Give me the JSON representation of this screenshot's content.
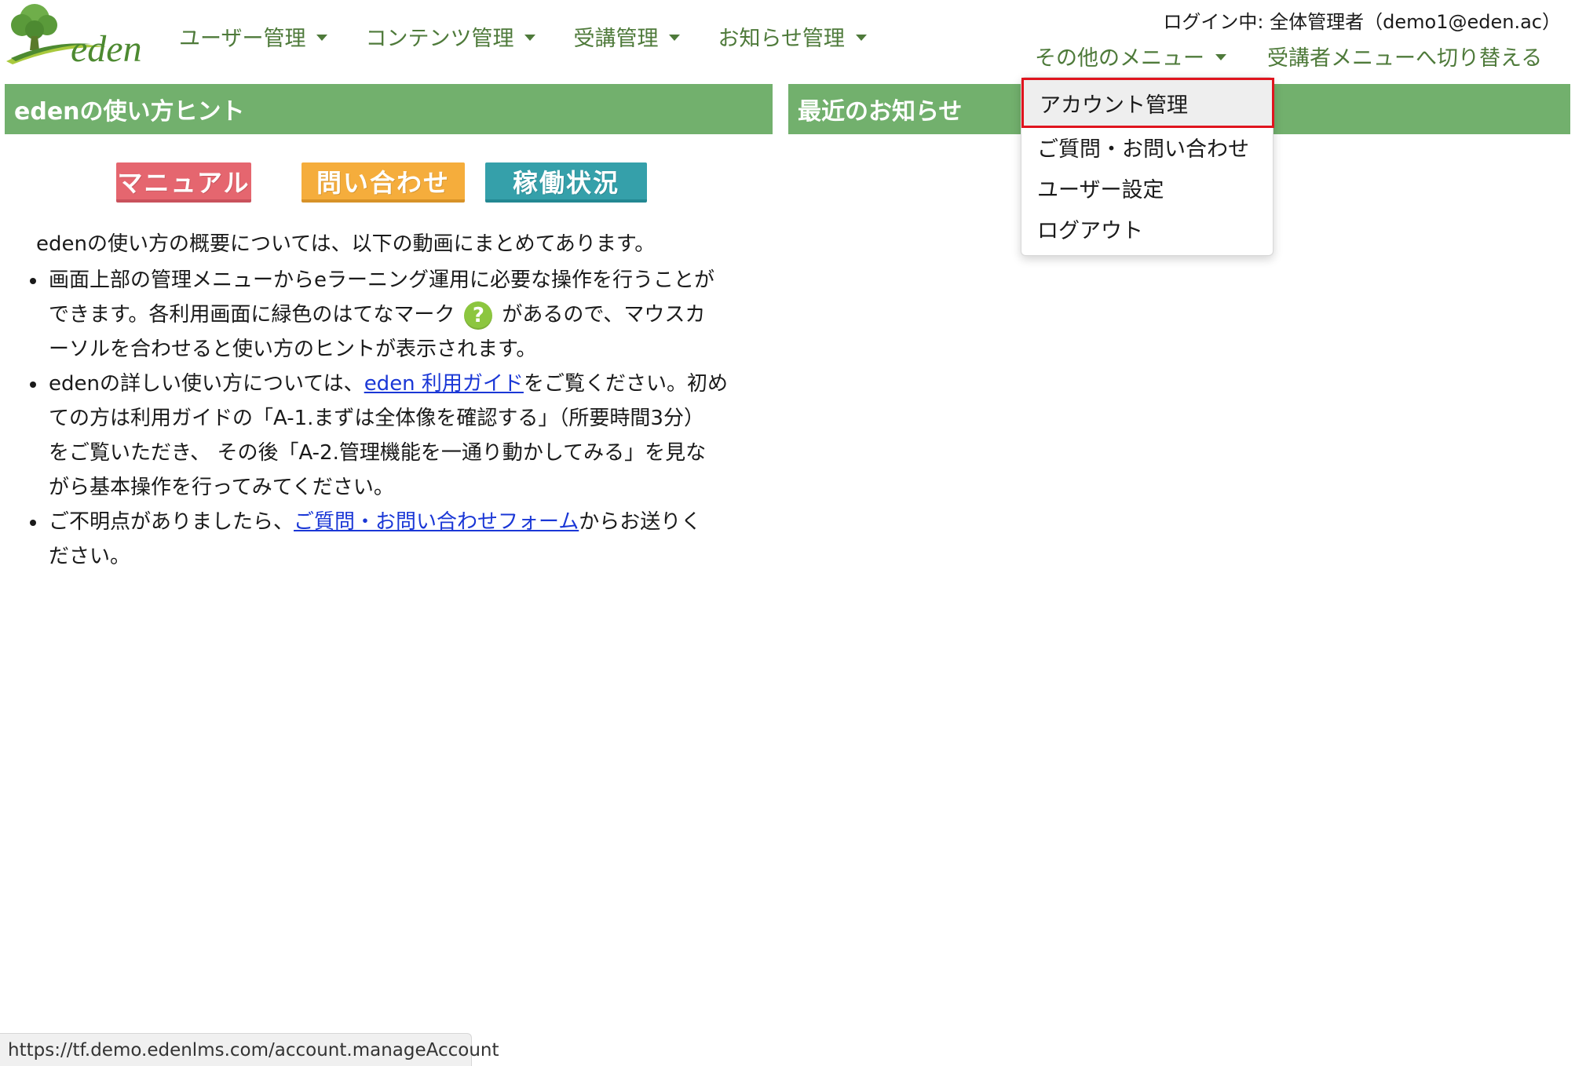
{
  "brand": {
    "logo_text": "eden",
    "logo_green": "#5a9a3a"
  },
  "nav": {
    "items": [
      {
        "label": "ユーザー管理"
      },
      {
        "label": "コンテンツ管理"
      },
      {
        "label": "受講管理"
      },
      {
        "label": "お知らせ管理"
      }
    ]
  },
  "header": {
    "login_info": "ログイン中: 全体管理者（demo1@eden.ac）",
    "other_menu": "その他のメニュー",
    "switch_link": "受講者メニューへ切り替える"
  },
  "panels": {
    "hints_title": "edenの使い方ヒント",
    "news_title": "最近のお知らせ",
    "header_color": "#72b06d"
  },
  "buttons": {
    "manual": "マニュアル",
    "contact": "問い合わせ",
    "status": "稼働状況"
  },
  "content": {
    "intro": "edenの使い方の概要については、以下の動画にまとめてあります。",
    "b1_l1": "画面上部の管理メニューからeラーニング運用に必要な操作を行うことが",
    "b1_l2a": "できます。各利用画面に緑色のはてなマーク",
    "b1_l2b": "があるので、マウスカ",
    "b1_l3": "ーソルを合わせると使い方のヒントが表示されます。",
    "help_mark": "?",
    "b2_l1a": "edenの詳しい使い方については、",
    "b2_link": "eden 利用ガイド",
    "b2_l1b": "をご覧ください。初め",
    "b2_l2": "ての方は利用ガイドの「A-1.まずは全体像を確認する」（所要時間3分）",
    "b2_l3": "をご覧いただき、 その後「A-2.管理機能を一通り動かしてみる」を見な",
    "b2_l4": "がら基本操作を行ってみてください。",
    "b3_l1a": "ご不明点がありましたら、",
    "b3_link": "ご質問・お問い合わせフォーム",
    "b3_l1b": "からお送りく",
    "b3_l2": "ださい。"
  },
  "dropdown": {
    "items": [
      {
        "label": "アカウント管理"
      },
      {
        "label": "ご質問・お問い合わせ"
      },
      {
        "label": "ユーザー設定"
      },
      {
        "label": "ログアウト"
      }
    ],
    "highlight_color": "#e0141e"
  },
  "statusbar": {
    "url": "https://tf.demo.edenlms.com/account.manageAccount"
  }
}
